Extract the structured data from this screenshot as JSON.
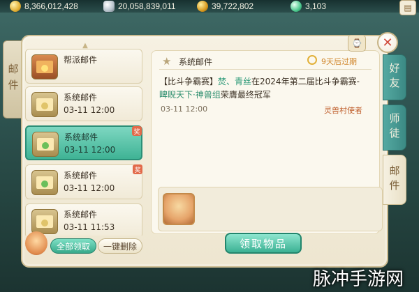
{
  "currencies": [
    {
      "icon": "gold-ingot-icon",
      "value": "8,366,012,428"
    },
    {
      "icon": "silver-icon",
      "value": "20,058,839,011"
    },
    {
      "icon": "coin-icon",
      "value": "39,722,802"
    },
    {
      "icon": "jade-icon",
      "value": "3,103"
    }
  ],
  "left_tab": {
    "label": "邮件"
  },
  "mail_list": [
    {
      "icon": "guild-chest-icon",
      "title": "帮派邮件",
      "date": ""
    },
    {
      "icon": "envelope-icon",
      "title": "系统邮件",
      "date": "03-11 12:00"
    },
    {
      "icon": "envelope-icon",
      "title": "系统邮件",
      "date": "03-11 12:00",
      "badge": "奖"
    },
    {
      "icon": "envelope-icon",
      "title": "系统邮件",
      "date": "03-11 12:00",
      "badge": "奖"
    },
    {
      "icon": "envelope-icon",
      "title": "系统邮件",
      "date": "03-11 11:53"
    }
  ],
  "buttons": {
    "claim_all": "全部领取",
    "delete_all": "一键删除",
    "claim": "领取物品"
  },
  "message": {
    "sender": "系统邮件",
    "expire": "9天后过期",
    "body_prefix": "【比斗争霸赛】",
    "names": "焚、青丝",
    "body_mid": "在2024年第二届比斗争霸赛-",
    "team": "睥睨天下·神兽组",
    "body_suffix": "荣膺最终冠军",
    "date": "03-11 12:00",
    "signer": "灵兽村使者"
  },
  "right_tabs": [
    "好友",
    "师徒",
    "邮件"
  ],
  "watermark": "脉冲手游网"
}
